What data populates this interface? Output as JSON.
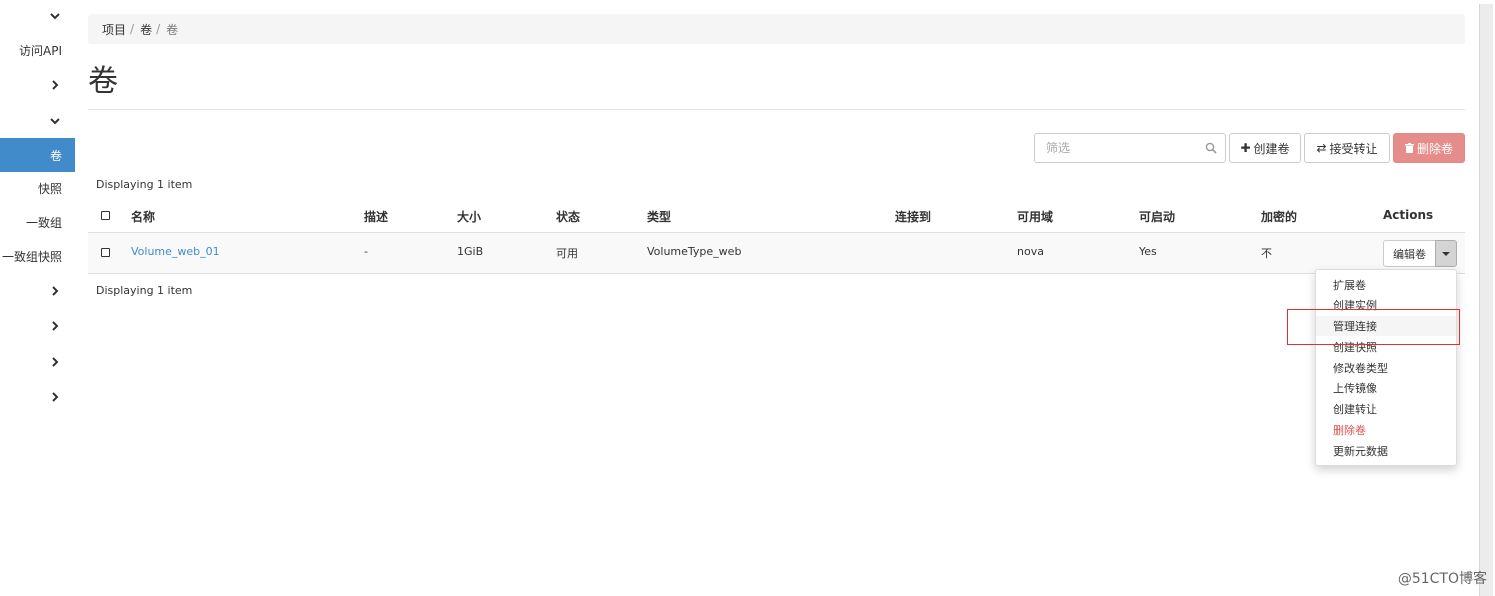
{
  "sidebar": {
    "chevrons": [
      "chevron-down-icon",
      "chevron-right-icon",
      "chevron-down-icon",
      "chevron-right-icon",
      "chevron-right-icon",
      "chevron-right-icon",
      "chevron-right-icon"
    ],
    "items": [
      {
        "label": "访问API",
        "active": false
      },
      {
        "label": "卷",
        "active": true
      },
      {
        "label": "快照",
        "active": false
      },
      {
        "label": "一致组",
        "active": false
      },
      {
        "label": "一致组快照",
        "active": false
      }
    ]
  },
  "breadcrumb": {
    "items": [
      "项目",
      "卷",
      "卷"
    ],
    "separator": "/"
  },
  "page": {
    "title": "卷"
  },
  "toolbar": {
    "filter_placeholder": "筛选",
    "create_label": "创建卷",
    "accept_label": "接受转让",
    "delete_label": "删除卷"
  },
  "table": {
    "count_text": "Displaying 1 item",
    "columns": [
      "名称",
      "描述",
      "大小",
      "状态",
      "类型",
      "连接到",
      "可用域",
      "可启动",
      "加密的",
      "Actions"
    ],
    "rows": [
      {
        "name": "Volume_web_01",
        "description": "-",
        "size": "1GiB",
        "status": "可用",
        "type": "VolumeType_web",
        "attached_to": "",
        "zone": "nova",
        "bootable": "Yes",
        "encrypted": "不",
        "action": "编辑卷"
      }
    ]
  },
  "dropdown": {
    "items": [
      "扩展卷",
      "创建实例",
      "管理连接",
      "创建快照",
      "修改卷类型",
      "上传镜像",
      "创建转让",
      "删除卷",
      "更新元数据"
    ],
    "hovered": "管理连接",
    "danger": "删除卷"
  },
  "watermark": "@51CTO博客",
  "colors": {
    "accent": "#428bca",
    "danger_button": "#e68c8a",
    "danger_text": "#d9534f",
    "highlight": "#e0302b"
  }
}
